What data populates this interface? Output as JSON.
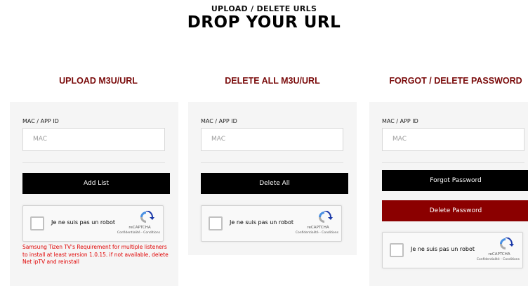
{
  "header": {
    "subtitle": "UPLOAD / DELETE URLS",
    "title": "DROP YOUR URL"
  },
  "colors": {
    "section_title": "#7a0b0b",
    "button_primary": "#000000",
    "button_danger": "#8b0000",
    "warning_text": "#e00000",
    "panel_bg": "#f5f5f5"
  },
  "columns": [
    {
      "title": "UPLOAD M3U/URL",
      "field_label": "MAC / APP ID",
      "field_placeholder": "MAC",
      "button": "Add List",
      "warning": "Samsung Tizen TV's Requirement for multiple listeners to install at least version 1.0.15. if not available, delete Net ipTV and reinstall"
    },
    {
      "title": "DELETE ALL M3U/URL",
      "field_label": "MAC / APP ID",
      "field_placeholder": "MAC",
      "button": "Delete All"
    },
    {
      "title": "FORGOT / DELETE PASSWORD",
      "field_label": "MAC / APP ID",
      "field_placeholder": "MAC",
      "button_forgot": "Forgot Password",
      "button_delete": "Delete Password"
    }
  ],
  "captcha": {
    "checkbox_label": "Je ne suis pas un robot",
    "brand": "reCAPTCHA",
    "links": "Confidentialité - Conditions",
    "icon": "recaptcha-logo-icon"
  }
}
